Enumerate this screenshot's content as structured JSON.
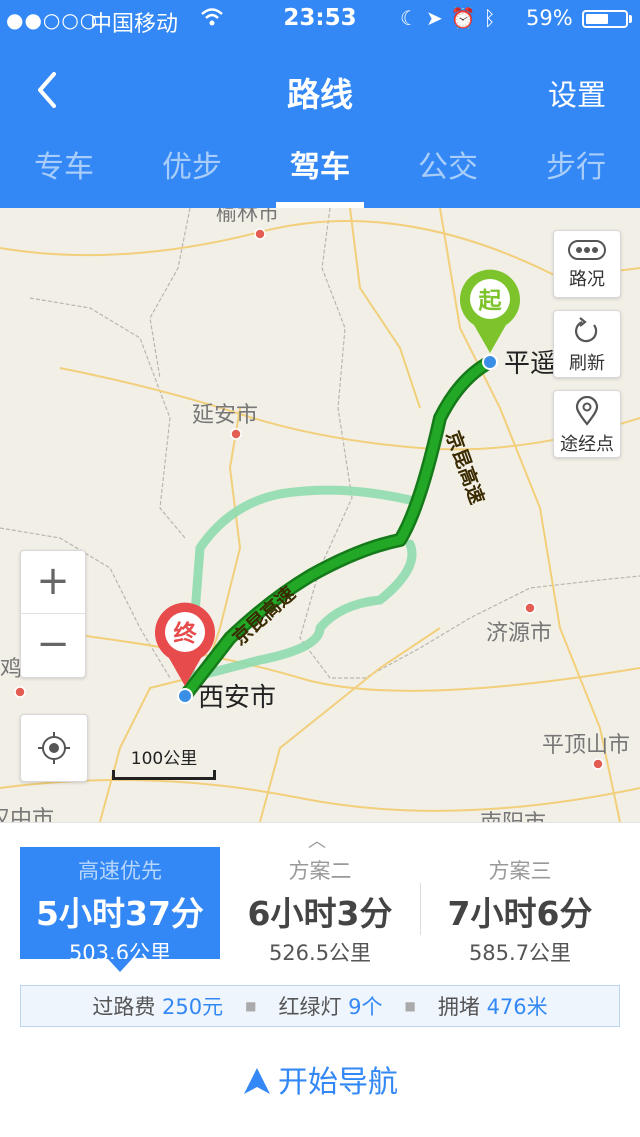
{
  "status": {
    "signal": "●●○○○",
    "carrier": "中国移动",
    "time": "23:53",
    "battery": "59%",
    "battery_level": 0.59
  },
  "nav": {
    "title": "路线",
    "settings": "设置"
  },
  "tabs": [
    {
      "label": "专车"
    },
    {
      "label": "优步"
    },
    {
      "label": "驾车"
    },
    {
      "label": "公交"
    },
    {
      "label": "步行"
    }
  ],
  "active_tab": 2,
  "map": {
    "cities": {
      "yulin": "榆林市",
      "yanan": "延安市",
      "jiyuan": "济源市",
      "pingdingshan": "平顶山市",
      "baoji": "宝鸡市",
      "nanyang": "南阳市",
      "hanzhong": "汉中市"
    },
    "start_label": "平遥古城",
    "end_label": "西安市",
    "start_marker": "起",
    "end_marker": "终",
    "highway_label": "京昆高速",
    "controls": {
      "traffic": "路况",
      "refresh": "刷新",
      "waypoint": "途经点"
    },
    "scale": "100公里",
    "colors": {
      "route_main": "#22a826",
      "route_alt": "#8fdcae",
      "start_pin": "#7cc32c",
      "end_pin": "#e84b4b"
    }
  },
  "routes": [
    {
      "name": "高速优先",
      "time": "5小时37分",
      "distance": "503.6公里"
    },
    {
      "name": "方案二",
      "time": "6小时3分",
      "distance": "526.5公里"
    },
    {
      "name": "方案三",
      "time": "7小时6分",
      "distance": "585.7公里"
    }
  ],
  "info": {
    "toll_label": "过路费",
    "toll_value": "250元",
    "lights_label": "红绿灯",
    "lights_value": "9个",
    "congestion_label": "拥堵",
    "congestion_value": "476米"
  },
  "start_nav": "开始导航"
}
